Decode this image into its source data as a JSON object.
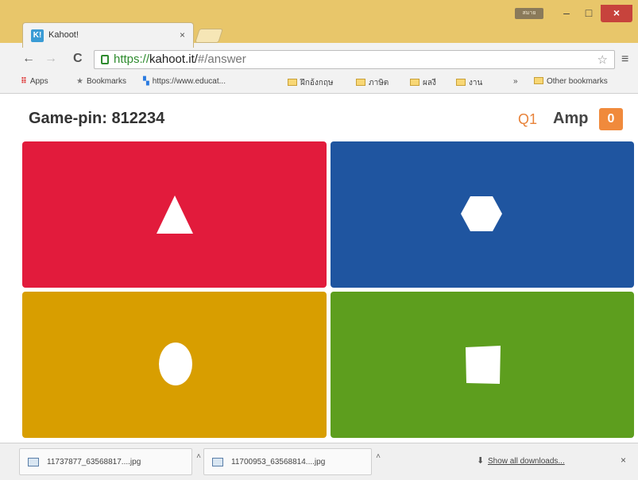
{
  "browser": {
    "user_badge": "สมาย",
    "tab": {
      "favicon": "K!",
      "title": "Kahoot!",
      "close": "×"
    },
    "window_controls": {
      "minimize": "–",
      "maximize": "□",
      "close": "×"
    },
    "toolbar": {
      "back": "←",
      "forward": "→",
      "reload": "C",
      "url_scheme": "https://",
      "url_host": "kahoot.it/",
      "url_path": "#/answer",
      "star": "☆",
      "menu": "≡"
    },
    "bookmarks": [
      {
        "label": "Apps",
        "icon": "apps-grid-icon"
      },
      {
        "label": "Bookmarks",
        "icon": "star-icon"
      },
      {
        "label": "https://www.educat...",
        "icon": "colorful-tiles-icon"
      },
      {
        "label": "ฝึกอ้งกฤษ",
        "icon": "folder-icon"
      },
      {
        "label": "ภาษิต",
        "icon": "folder-icon"
      },
      {
        "label": "ผลงี",
        "icon": "folder-icon"
      },
      {
        "label": "งาน",
        "icon": "folder-icon"
      },
      {
        "label": "»",
        "icon": ""
      },
      {
        "label": "Other bookmarks",
        "icon": "folder-icon"
      }
    ]
  },
  "game": {
    "pin_label": "Game-pin: 812234",
    "question": "Q1",
    "nickname": "Amp",
    "score": "0",
    "answers": [
      {
        "color": "#e21b3c",
        "shape": "triangle"
      },
      {
        "color": "#1f55a0",
        "shape": "hexagon"
      },
      {
        "color": "#d89e00",
        "shape": "circle"
      },
      {
        "color": "#5d9e1e",
        "shape": "square"
      }
    ]
  },
  "downloads": {
    "items": [
      {
        "name": "11737877_63568817....jpg"
      },
      {
        "name": "11700953_63568814....jpg"
      }
    ],
    "show_all": "Show all downloads...",
    "close": "×"
  }
}
